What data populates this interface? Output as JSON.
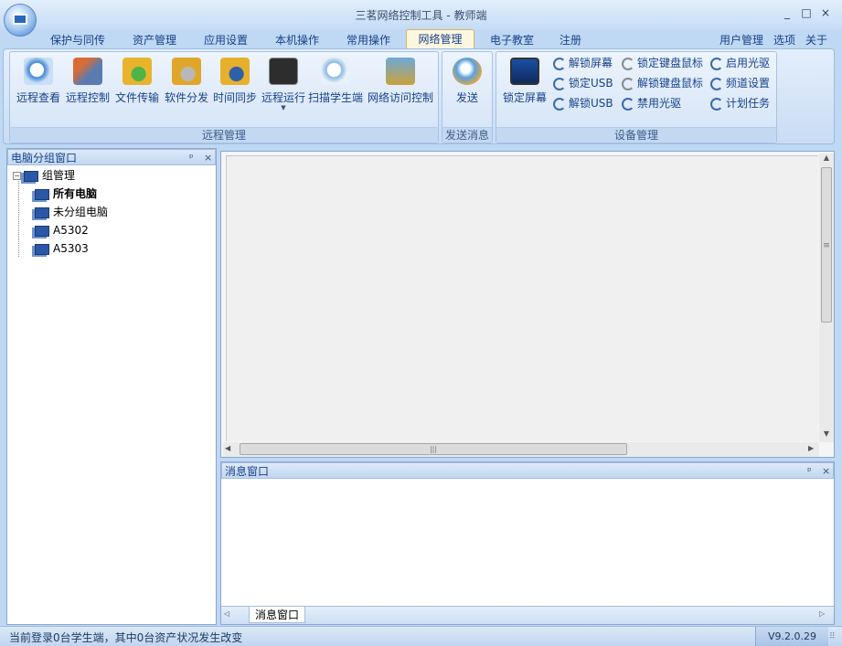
{
  "window": {
    "title": "三茗网络控制工具 - 教师端",
    "min": "_",
    "max": "□",
    "close": "×"
  },
  "tabs": [
    {
      "label": "保护与同传"
    },
    {
      "label": "资产管理"
    },
    {
      "label": "应用设置"
    },
    {
      "label": "本机操作"
    },
    {
      "label": "常用操作"
    },
    {
      "label": "网络管理"
    },
    {
      "label": "电子教室"
    },
    {
      "label": "注册"
    }
  ],
  "right_menu": {
    "user": "用户管理",
    "options": "选项",
    "about": "关于"
  },
  "groups": {
    "remote": {
      "label": "远程管理",
      "buttons": [
        {
          "label": "远程查看",
          "icon": "magnifier-icon",
          "color": "#3f86d6"
        },
        {
          "label": "远程控制",
          "icon": "tools-icon",
          "color": "#d96b37"
        },
        {
          "label": "文件传输",
          "icon": "folder-sync-icon",
          "color": "#e8b42e"
        },
        {
          "label": "软件分发",
          "icon": "folder-gear-icon",
          "color": "#e0a62a"
        },
        {
          "label": "时间同步",
          "icon": "folder-clock-icon",
          "color": "#e7b02c"
        },
        {
          "label": "远程运行",
          "icon": "terminal-icon",
          "color": "#2d2d2d"
        },
        {
          "label": "扫描学生端",
          "icon": "scan-icon",
          "color": "#8ab7e5"
        },
        {
          "label": "网络访问控制",
          "icon": "network-lock-icon",
          "color": "#6fa8d8"
        }
      ]
    },
    "msg": {
      "label": "发送消息",
      "button": "发送"
    },
    "device": {
      "label": "设备管理",
      "lock_screen": "锁定屏幕",
      "small": [
        "解锁屏幕",
        "锁定键盘鼠标",
        "启用光驱",
        "锁定USB",
        "解锁键盘鼠标",
        "频道设置",
        "解锁USB",
        "禁用光驱",
        "计划任务"
      ]
    }
  },
  "left_panel": {
    "title": "电脑分组窗口",
    "pin": "ᵖ",
    "close": "×",
    "tree": {
      "root": "组管理",
      "children": [
        "所有电脑",
        "未分组电脑",
        "A5302",
        "A5303"
      ]
    }
  },
  "message_panel": {
    "title": "消息窗口",
    "pin": "ᵖ",
    "close": "×",
    "tab": "消息窗口"
  },
  "scroll": {
    "h_grip": "|||",
    "v_grip": "≡"
  },
  "status": {
    "text": "当前登录0台学生端，其中0台资产状况发生改变",
    "version": "V9.2.0.29"
  }
}
